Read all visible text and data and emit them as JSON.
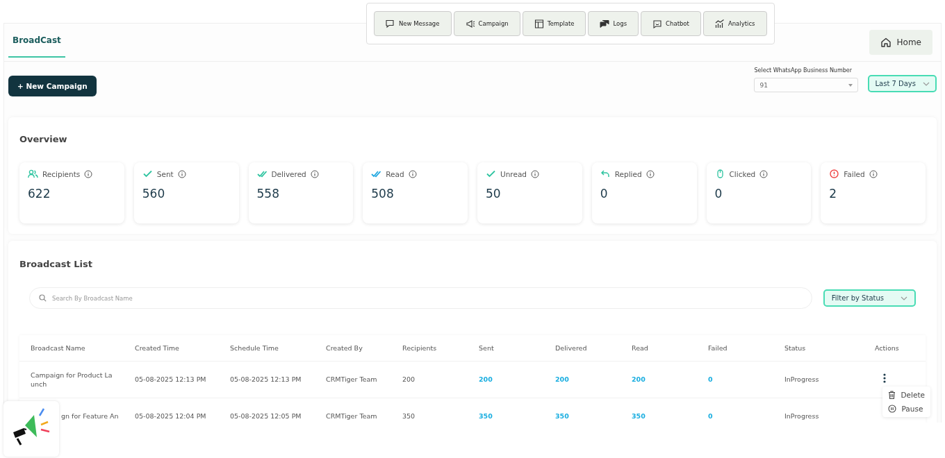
{
  "toolbar": [
    {
      "label": "New Message"
    },
    {
      "label": "Campaign"
    },
    {
      "label": "Template"
    },
    {
      "label": "Logs"
    },
    {
      "label": "Chatbot"
    },
    {
      "label": "Analytics"
    }
  ],
  "tabs": [
    {
      "label": "BroadCast",
      "selected": true
    }
  ],
  "home_button": "Home",
  "new_campaign_button": "+ New Campaign",
  "number_select": {
    "label": "Select WhatsApp Business Number",
    "value": "91"
  },
  "period_select": "Last 7 Days",
  "overview": {
    "title": "Overview",
    "stats": [
      {
        "label": "Recipients",
        "value": "622"
      },
      {
        "label": "Sent",
        "value": "560"
      },
      {
        "label": "Delivered",
        "value": "558"
      },
      {
        "label": "Read",
        "value": "508"
      },
      {
        "label": "Unread",
        "value": "50"
      },
      {
        "label": "Replied",
        "value": "0"
      },
      {
        "label": "Clicked",
        "value": "0"
      },
      {
        "label": "Failed",
        "value": "2"
      }
    ]
  },
  "broadcast_list": {
    "title": "Broadcast List",
    "search": {
      "placeholder": "Search By Broadcast Name"
    },
    "filter": "Filter by Status",
    "columns": [
      {
        "label": "Broadcast Name",
        "kind": "text"
      },
      {
        "label": "Created Time",
        "kind": "text"
      },
      {
        "label": "Schedule Time",
        "kind": "text"
      },
      {
        "label": "Created By",
        "kind": "text"
      },
      {
        "label": "Recipients",
        "kind": "text"
      },
      {
        "label": "Sent",
        "kind": "count"
      },
      {
        "label": "Delivered",
        "kind": "count"
      },
      {
        "label": "Read",
        "kind": "count"
      },
      {
        "label": "Failed",
        "kind": "count"
      },
      {
        "label": "Status",
        "kind": "text"
      },
      {
        "label": "Actions",
        "kind": "actions"
      }
    ],
    "rows": [
      {
        "partly_hidden": false,
        "cells": [
          "Campaign for Product La unch",
          "05-08-2025 12:13 PM",
          "05-08-2025 12:13 PM",
          "CRMTiger Team",
          "200",
          "200",
          "200",
          "200",
          "0",
          "InProgress"
        ]
      },
      {
        "partly_hidden": true,
        "cells": [
          "gn for Feature An",
          "05-08-2025 12:04 PM",
          "05-08-2025 12:05 PM",
          "CRMTiger Team",
          "350",
          "350",
          "350",
          "350",
          "0",
          "InProgress"
        ]
      }
    ],
    "action_menu": [
      {
        "label": "Delete"
      },
      {
        "label": "Pause"
      }
    ]
  }
}
